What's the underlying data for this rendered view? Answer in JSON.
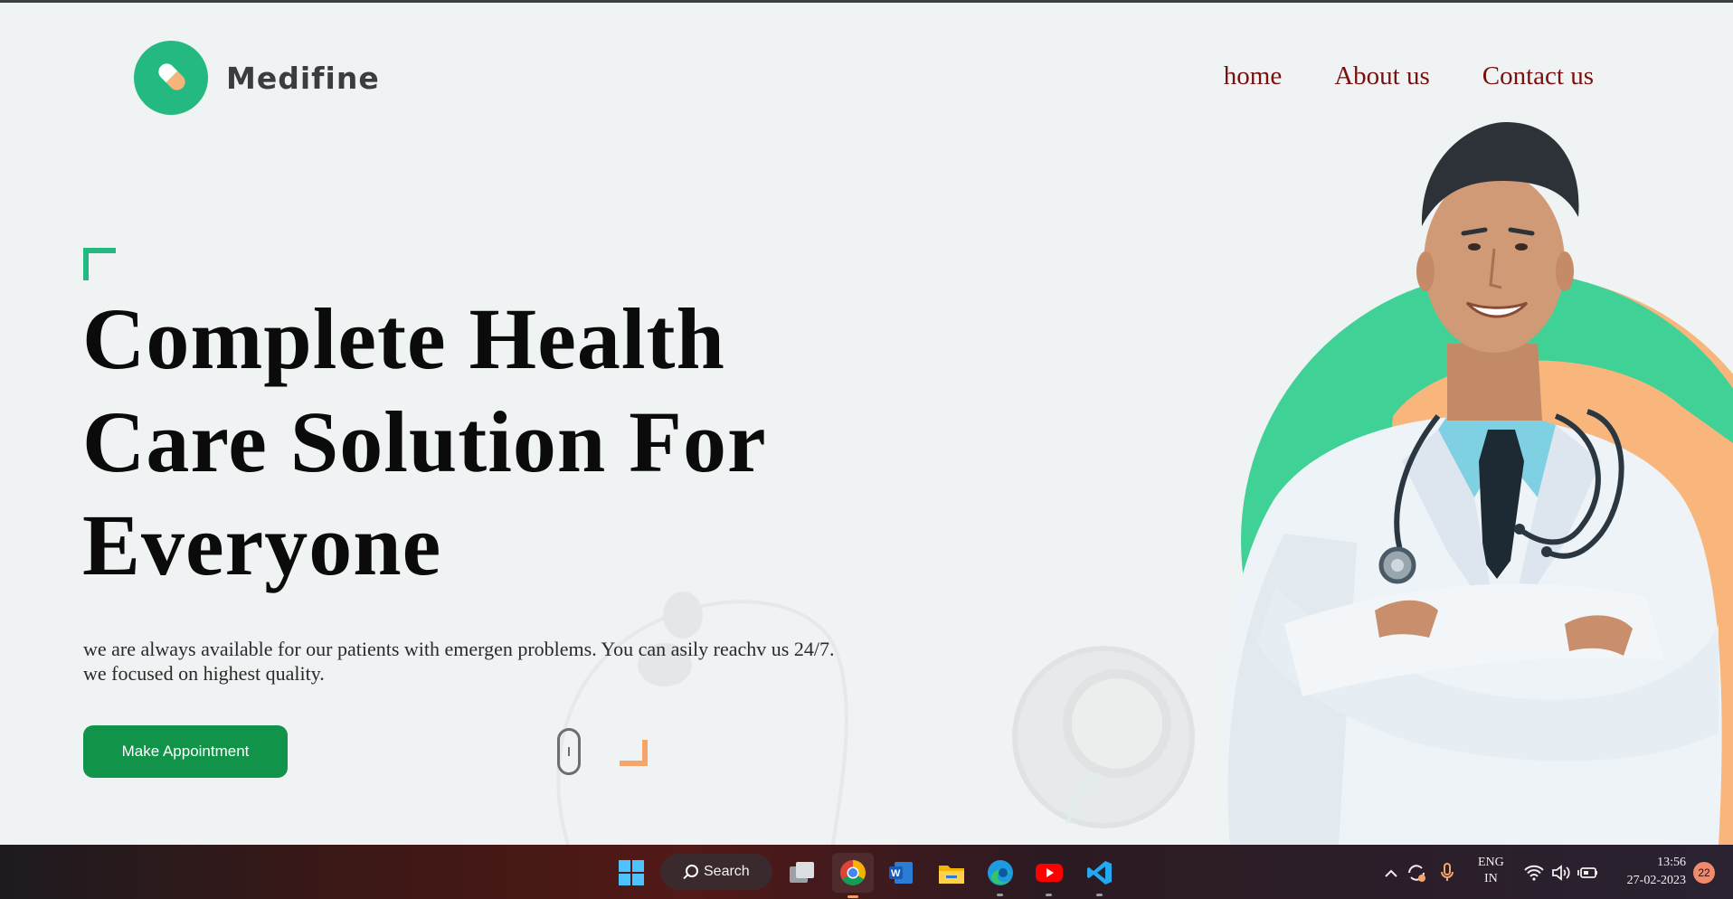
{
  "brand": {
    "name": "Medifine",
    "accent": "#23b981",
    "pill_color": "#f7b47a"
  },
  "nav": {
    "items": [
      {
        "label": "home"
      },
      {
        "label": "About us"
      },
      {
        "label": "Contact us"
      }
    ],
    "color": "#7a0f0f"
  },
  "hero": {
    "headline": [
      "Complete Health",
      "Care Solution For",
      "Everyone"
    ],
    "description": "we are always available for our patients with emergen problems. You can asily reachv us 24/7. we focused on highest quality.",
    "cta_label": "Make Appointment",
    "cta_color": "#11944a",
    "illustration": "smiling-doctor-with-stethoscope"
  },
  "taskbar": {
    "search_label": "Search",
    "apps": [
      "windows-start-icon",
      "task-view-icon",
      "chrome-icon",
      "word-icon",
      "file-explorer-icon",
      "edge-icon",
      "youtube-icon",
      "vscode-icon"
    ],
    "active_app": "chrome-icon",
    "language": [
      "ENG",
      "IN"
    ],
    "time": "13:56",
    "date": "27-02-2023",
    "notifications": "22"
  }
}
